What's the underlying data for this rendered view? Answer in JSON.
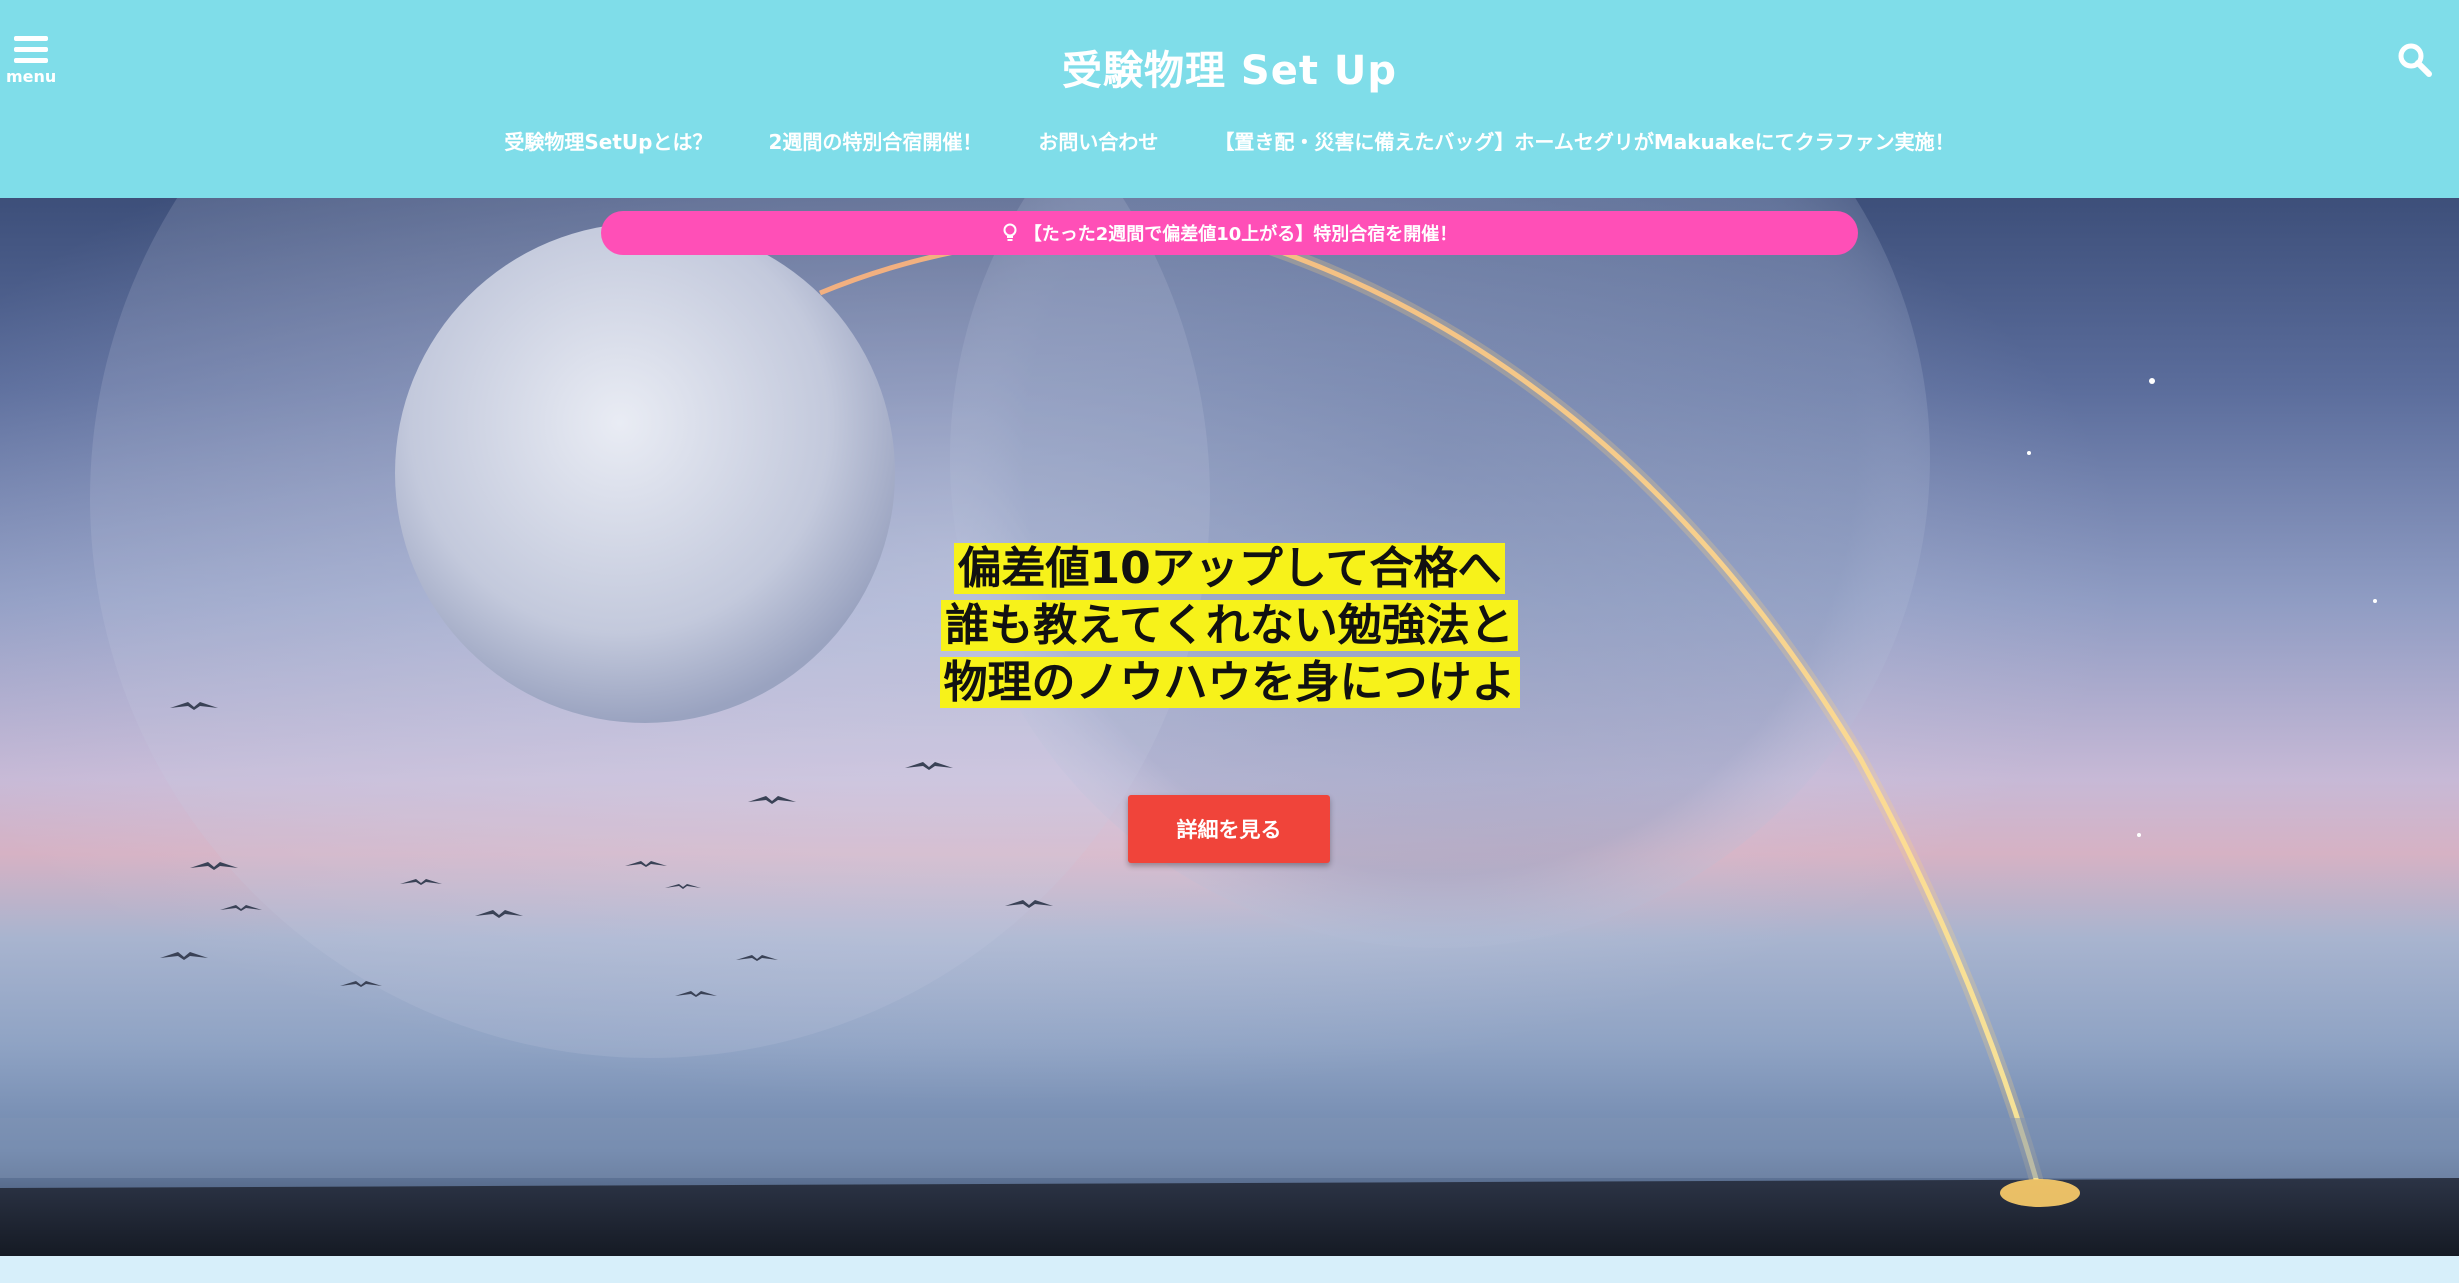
{
  "header": {
    "menu_label": "menu",
    "site_title": "受験物理 Set Up",
    "menu_icon": "hamburger-icon",
    "search_icon": "search-icon",
    "nav": [
      {
        "label": "受験物理SetUpとは？"
      },
      {
        "label": "2週間の特別合宿開催！"
      },
      {
        "label": "お問い合わせ"
      },
      {
        "label": "【置き配・災害に備えたバッグ】ホームセグリがMakuakeにてクラファン実施！"
      }
    ],
    "bg_color": "#7fdde9"
  },
  "banner": {
    "icon": "lightbulb-icon",
    "text": "【たった2週間で偏差値10上がる】特別合宿を開催！",
    "color": "#ff4fb7"
  },
  "hero": {
    "headline_lines": [
      "偏差値10アップして合格へ",
      "誰も教えてくれない勉強法と",
      "物理のノウハウを身につけよ"
    ],
    "highlight_color": "#f7f21a",
    "cta_label": "詳細を見る",
    "cta_color": "#f0443a"
  }
}
